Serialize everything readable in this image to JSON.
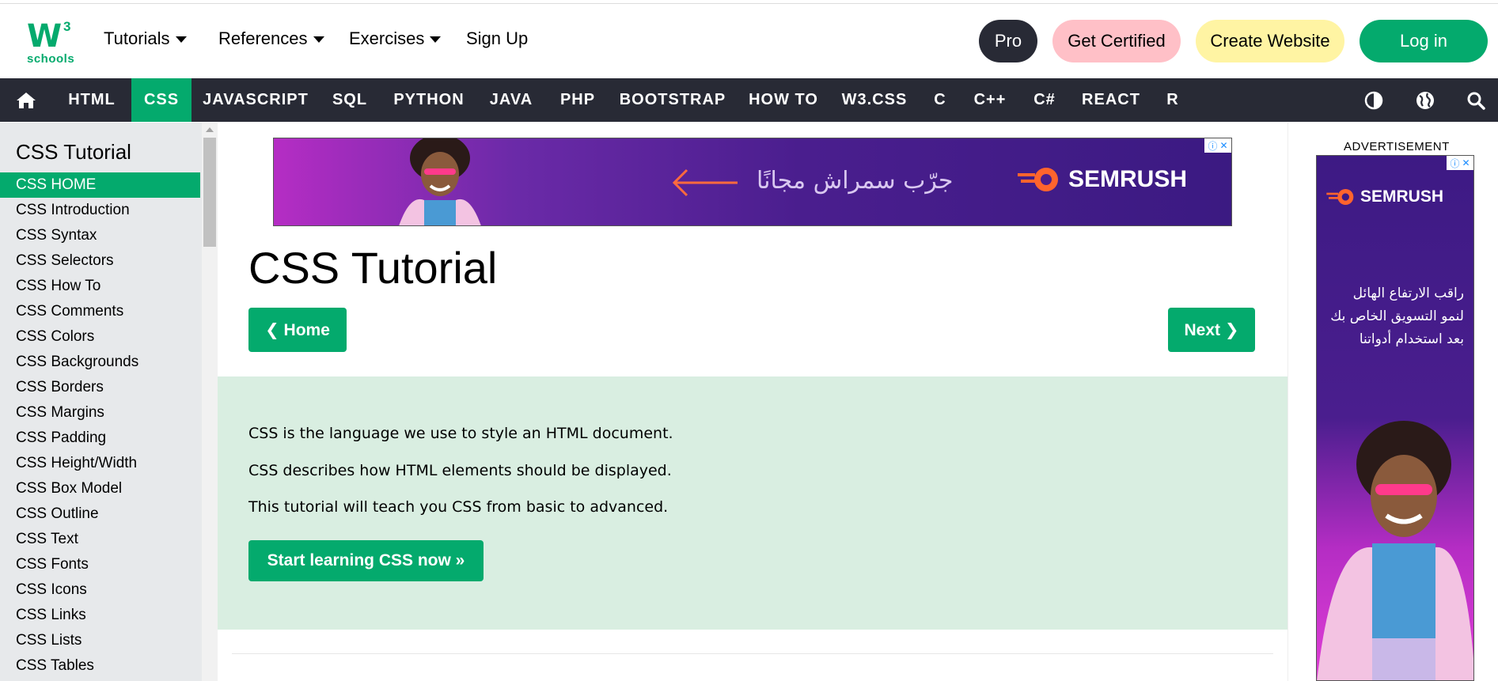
{
  "header": {
    "logo": {
      "mark": "W",
      "sup": "3",
      "sub": "schools"
    },
    "menus": [
      {
        "label": "Tutorials",
        "has_caret": true
      },
      {
        "label": "References",
        "has_caret": true
      },
      {
        "label": "Exercises",
        "has_caret": true
      },
      {
        "label": "Sign Up",
        "has_caret": false
      }
    ],
    "pro_label": "Pro",
    "certified_label": "Get Certified",
    "create_label": "Create Website",
    "login_label": "Log in"
  },
  "topnav": {
    "items": [
      "HTML",
      "CSS",
      "JAVASCRIPT",
      "SQL",
      "PYTHON",
      "JAVA",
      "PHP",
      "BOOTSTRAP",
      "HOW TO",
      "W3.CSS",
      "C",
      "C++",
      "C#",
      "REACT",
      "R"
    ],
    "active": "CSS",
    "icons": [
      "home-icon",
      "contrast-icon",
      "globe-icon",
      "search-icon"
    ]
  },
  "sidebar": {
    "title": "CSS Tutorial",
    "items": [
      "CSS HOME",
      "CSS Introduction",
      "CSS Syntax",
      "CSS Selectors",
      "CSS How To",
      "CSS Comments",
      "CSS Colors",
      "CSS Backgrounds",
      "CSS Borders",
      "CSS Margins",
      "CSS Padding",
      "CSS Height/Width",
      "CSS Box Model",
      "CSS Outline",
      "CSS Text",
      "CSS Fonts",
      "CSS Icons",
      "CSS Links",
      "CSS Lists",
      "CSS Tables"
    ],
    "active": "CSS HOME"
  },
  "ads": {
    "top_brand": "SEMRUSH",
    "top_text": "جرّب سمراش مجانًا",
    "right_label": "ADVERTISEMENT",
    "right_brand": "SEMRUSH",
    "right_text": [
      "راقب الارتفاع الهائل",
      "لنمو التسويق الخاص بك",
      "بعد استخدام أدواتنا"
    ]
  },
  "main": {
    "title": "CSS Tutorial",
    "home_button": "❮ Home",
    "next_button": "Next ❯",
    "intro": [
      "CSS is the language we use to style an HTML document.",
      "CSS describes how HTML elements should be displayed.",
      "This tutorial will teach you CSS from basic to advanced."
    ],
    "start_button": "Start learning CSS now »"
  },
  "colors": {
    "brand_green": "#04aa6d",
    "dark_nav": "#282a35",
    "pink": "#ffc0c7",
    "yellow": "#fff4a3",
    "intro_bg": "#d9eee1",
    "sidebar_bg": "#e7e9eb"
  }
}
